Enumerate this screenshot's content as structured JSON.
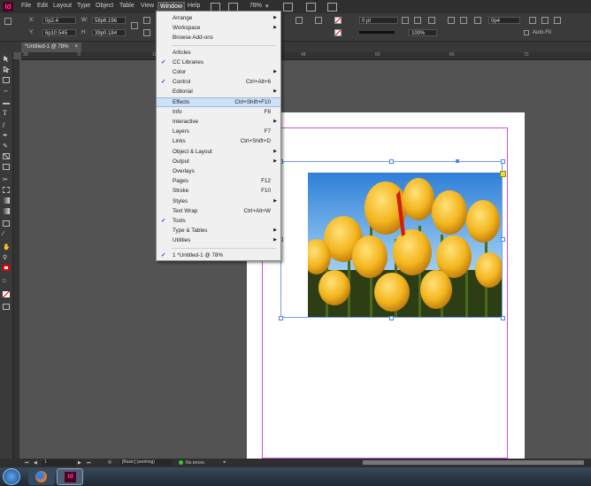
{
  "app": {
    "logo": "Id",
    "menus": [
      "File",
      "Edit",
      "Layout",
      "Type",
      "Object",
      "Table",
      "View",
      "Window",
      "Help"
    ],
    "active_menu": "Window",
    "zoom": "78%"
  },
  "control_panel": {
    "x_label": "X:",
    "x_value": "0p2.4",
    "y_label": "Y:",
    "y_value": "6p10.545",
    "w_label": "W:",
    "w_value": "58p6.196",
    "h_label": "H:",
    "h_value": "39p0.184",
    "stroke_weight": "0 pt",
    "opacity": "100%",
    "ref_value": "0p4",
    "auto_fit": "Auto-Fit"
  },
  "document_tab": {
    "title": "*Untitled-1 @ 78%",
    "close": "×"
  },
  "ruler": {
    "ticks": [
      "30",
      "18",
      "12",
      "6",
      "0",
      "6",
      "12",
      "18",
      "24",
      "30",
      "36",
      "42",
      "48",
      "54",
      "60",
      "66",
      "72"
    ]
  },
  "window_menu": {
    "items": [
      {
        "label": "Arrange",
        "shortcut": "",
        "submenu": true,
        "checked": false
      },
      {
        "label": "Workspace",
        "shortcut": "",
        "submenu": true,
        "checked": false
      },
      {
        "label": "Browse Add-ons",
        "shortcut": "",
        "submenu": false,
        "checked": false
      },
      {
        "label": "Articles",
        "shortcut": "",
        "submenu": false,
        "checked": false
      },
      {
        "label": "CC Libraries",
        "shortcut": "",
        "submenu": false,
        "checked": true
      },
      {
        "label": "Color",
        "shortcut": "",
        "submenu": true,
        "checked": false
      },
      {
        "label": "Control",
        "shortcut": "Ctrl+Alt+6",
        "submenu": false,
        "checked": true
      },
      {
        "label": "Editorial",
        "shortcut": "",
        "submenu": true,
        "checked": false
      },
      {
        "label": "Effects",
        "shortcut": "Ctrl+Shift+F10",
        "submenu": false,
        "checked": false
      },
      {
        "label": "Info",
        "shortcut": "F8",
        "submenu": false,
        "checked": false
      },
      {
        "label": "Interactive",
        "shortcut": "",
        "submenu": true,
        "checked": false
      },
      {
        "label": "Layers",
        "shortcut": "F7",
        "submenu": false,
        "checked": false
      },
      {
        "label": "Links",
        "shortcut": "Ctrl+Shift+D",
        "submenu": false,
        "checked": false
      },
      {
        "label": "Object & Layout",
        "shortcut": "",
        "submenu": true,
        "checked": false
      },
      {
        "label": "Output",
        "shortcut": "",
        "submenu": true,
        "checked": false
      },
      {
        "label": "Overlays",
        "shortcut": "",
        "submenu": false,
        "checked": false
      },
      {
        "label": "Pages",
        "shortcut": "F12",
        "submenu": false,
        "checked": false
      },
      {
        "label": "Stroke",
        "shortcut": "F10",
        "submenu": false,
        "checked": false
      },
      {
        "label": "Styles",
        "shortcut": "",
        "submenu": true,
        "checked": false
      },
      {
        "label": "Text Wrap",
        "shortcut": "Ctrl+Alt+W",
        "submenu": false,
        "checked": false
      },
      {
        "label": "Tools",
        "shortcut": "",
        "submenu": false,
        "checked": true
      },
      {
        "label": "Type & Tables",
        "shortcut": "",
        "submenu": true,
        "checked": false
      },
      {
        "label": "Utilities",
        "shortcut": "",
        "submenu": true,
        "checked": false
      },
      {
        "label": "1 *Untitled-1 @ 78%",
        "shortcut": "",
        "submenu": false,
        "checked": true
      }
    ],
    "highlighted": "Effects",
    "check_glyph": "✓",
    "arrow_glyph": "▶"
  },
  "status_bar": {
    "page": "1",
    "style": "[Basic] (working)",
    "errors": "No errors"
  },
  "colors": {
    "accent": "#6d9cf5",
    "margin_guide": "#d94cd9",
    "menu_highlight": "#cde1f7",
    "logo_bg": "#49021f"
  }
}
